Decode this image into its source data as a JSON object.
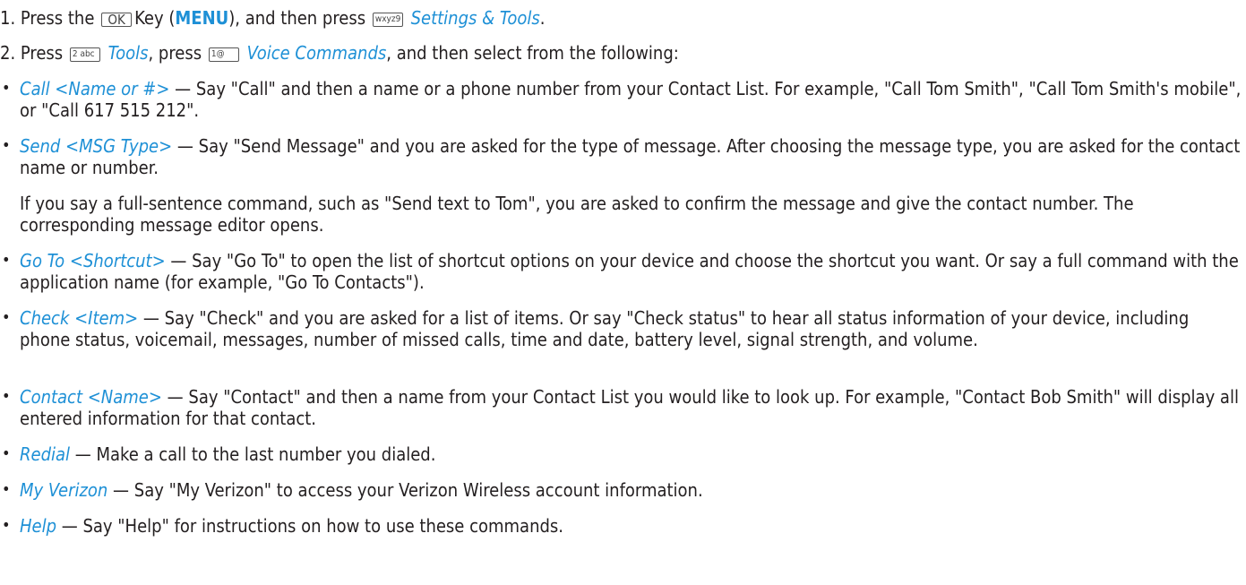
{
  "step1": {
    "num": "1. Press the",
    "ok_key": "OK",
    "mid1": "Key (",
    "menu": "MENU",
    "mid2": "), and then press",
    "key9": "wxyz9",
    "settings": "Settings & Tools",
    "end": "."
  },
  "step2": {
    "num": "2. Press",
    "key2": "2 abc",
    "tools": "Tools",
    "mid1": ", press",
    "key1": "1@",
    "voice": "Voice Commands",
    "end": ", and then select from the following:"
  },
  "items": [
    {
      "term": "Call <Name or #>",
      "desc": " — Say \"Call\" and then a name or a phone number from your Contact List. For example, \"Call Tom Smith\", \"Call Tom Smith's mobile\", or \"Call 617 515 212\"."
    },
    {
      "term": "Send <MSG Type>",
      "desc": " — Say \"Send Message\" and you are asked for the type of message. After choosing the message type, you are asked for the contact name or number."
    },
    {
      "term": "Go To <Shortcut>",
      "desc": " — Say \"Go To\" to open the list of shortcut options on your device and choose the shortcut you want. Or say a full command with the application name (for example, \"Go To Contacts\")."
    },
    {
      "term": "Check <Item>",
      "desc": " — Say \"Check\" and you are asked for a list of items. Or say \"Check status\" to hear all status information of your device, including phone status, voicemail, messages, number of missed calls, time and date, battery level, signal strength, and volume."
    },
    {
      "term": "Contact <Name>",
      "desc": " — Say \"Contact\" and then a name from your Contact List you would like to look up. For example, \"Contact Bob Smith\" will display all entered information for that contact."
    },
    {
      "term": "Redial",
      "desc": " — Make a call to the last number you dialed."
    },
    {
      "term": "My Verizon",
      "desc": " — Say \"My Verizon\" to access your Verizon Wireless account information."
    },
    {
      "term": "Help",
      "desc": " — Say \"Help\" for instructions on how to use these commands."
    }
  ],
  "send_note": "If you say a full-sentence command, such as \"Send text to Tom\", you are asked to confirm the message and give the contact number. The corresponding message editor opens.",
  "bullet_char": "•"
}
